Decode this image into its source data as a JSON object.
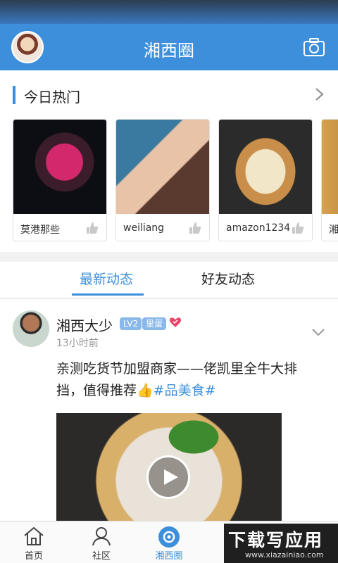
{
  "header": {
    "title": "湘西圈"
  },
  "hot": {
    "title": "今日热门",
    "items": [
      {
        "name": "莫港那些"
      },
      {
        "name": "weiliang"
      },
      {
        "name": "amazon1234"
      },
      {
        "name": "湘"
      }
    ]
  },
  "tabs": [
    {
      "label": "最新动态"
    },
    {
      "label": "好友动态"
    }
  ],
  "post": {
    "author": "湘西大少",
    "level": "LV2",
    "role": "里蛋",
    "time": "13小时前",
    "text": "亲测吃货节加盟商家——佬凯里全牛大排挡，值得推荐👍",
    "hashtag": "#品美食#"
  },
  "nav": [
    {
      "label": "首页",
      "icon": "home-icon"
    },
    {
      "label": "社区",
      "icon": "community-icon"
    },
    {
      "label": "湘西圈",
      "icon": "circle-icon"
    }
  ],
  "watermark": {
    "main": "下载写应用",
    "sub": "www.xiazainiao.com"
  },
  "colors": {
    "accent": "#3d8fdb",
    "header": "#3d8fdb"
  }
}
